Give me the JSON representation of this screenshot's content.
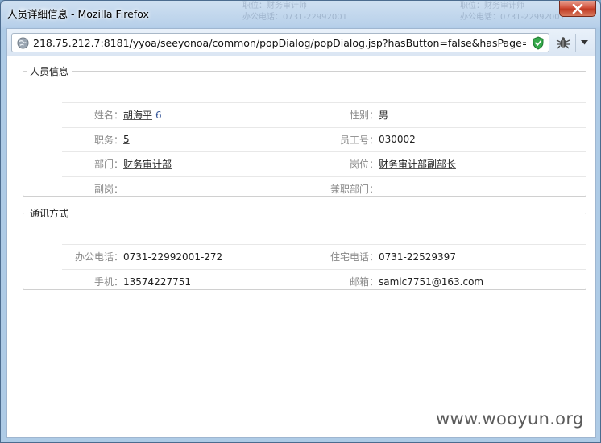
{
  "window": {
    "title": "人员详细信息 - Mozilla Firefox",
    "close_icon": "close-icon"
  },
  "background_ghost": {
    "left_lines": [
      "职位：财务审计师",
      "办公电话：0731-22992001"
    ],
    "right_lines": [
      "职位：财务审计师",
      "办公电话：0731-22992001"
    ]
  },
  "urlbar": {
    "url": "218.75.212.7:8181/yyoa/seeyonoa/common/popDialog/popDialog.jsp?hasButton=false&hasPage=true&",
    "icons": [
      "globe-icon",
      "shield-check-icon",
      "bug-icon",
      "chevron-down-icon"
    ]
  },
  "person": {
    "legend": "人员信息",
    "rows": [
      {
        "l1": "姓名：",
        "v1": "胡海平",
        "v1_suffix": "6",
        "l2": "性别：",
        "v2": "男"
      },
      {
        "l1": "职务：",
        "v1": "5",
        "l2": "员工号：",
        "v2": "030002"
      },
      {
        "l1": "部门：",
        "v1": "财务审计部",
        "l2": "岗位：",
        "v2": "财务审计部副部长"
      },
      {
        "l1": "副岗：",
        "v1": "",
        "l2": "兼职部门：",
        "v2": ""
      }
    ]
  },
  "contact": {
    "legend": "通讯方式",
    "rows": [
      {
        "l1": "办公电话：",
        "v1": "0731-22992001-272",
        "l2": "住宅电话：",
        "v2": "0731-22529397"
      },
      {
        "l1": "手机：",
        "v1": "13574227751",
        "l2": "邮箱：",
        "v2": "samic7751@163.com"
      }
    ]
  },
  "watermark": "www.wooyun.org",
  "colors": {
    "close_button": "#c13b24",
    "label_gray": "#8a8a8a",
    "suffix_blue": "#3a5a9a"
  }
}
